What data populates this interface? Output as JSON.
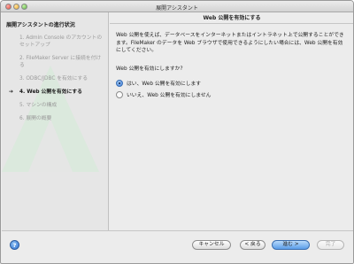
{
  "window": {
    "title": "展開アシスタント"
  },
  "sidebar": {
    "heading": "展開アシスタントの進行状況",
    "steps": [
      {
        "label": "1. Admin Console のアカウントのセットアップ",
        "active": false
      },
      {
        "label": "2. FileMaker Server に接続を付ける",
        "active": false
      },
      {
        "label": "3. ODBC/JDBC を有効にする",
        "active": false
      },
      {
        "label": "4. Web 公開を有効にする",
        "active": true
      },
      {
        "label": "5. マシンの構成",
        "active": false
      },
      {
        "label": "6. 展開の概要",
        "active": false
      }
    ],
    "current_marker": "➔"
  },
  "content": {
    "header": "Web 公開を有効にする",
    "description": "Web 公開を使えば、データベースをインターネットまたはイントラネット上で公開することができます。FileMaker のデータを Web ブラウザで使用できるようにしたい場合には、Web 公開を有効にしてください。",
    "question": "Web 公開を有効にしますか?",
    "options": [
      {
        "label": "はい、Web 公開を有効にします",
        "selected": true
      },
      {
        "label": "いいえ、Web 公開を有効にしません",
        "selected": false
      }
    ]
  },
  "footer": {
    "help_symbol": "?",
    "cancel_label": "キャンセル",
    "back_label": "< 戻る",
    "next_label": "進む >",
    "finish_label": "完了"
  },
  "colors": {
    "accent": "#5b9de8",
    "watermark": "#c9e3cf"
  }
}
